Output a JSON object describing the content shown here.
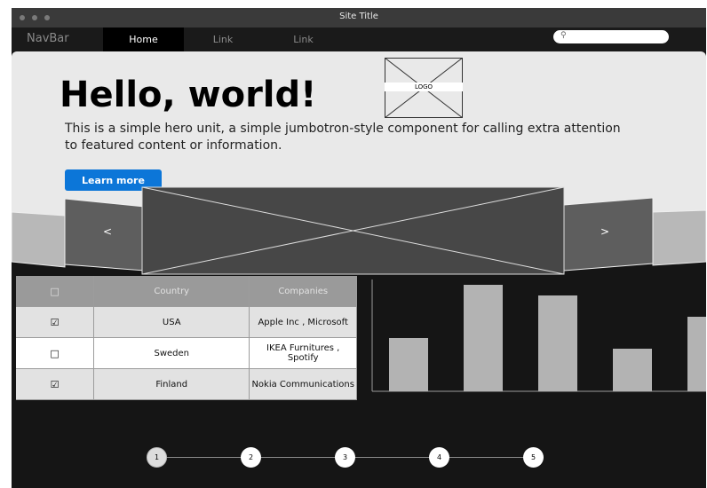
{
  "window": {
    "title": "Site Title"
  },
  "navbar": {
    "brand": "NavBar",
    "links": [
      {
        "label": "Home",
        "active": true
      },
      {
        "label": "Link",
        "active": false
      },
      {
        "label": "Link",
        "active": false
      }
    ],
    "search": {
      "placeholder": "",
      "icon": "search-icon"
    }
  },
  "hero": {
    "heading": "Hello, world!",
    "text": "This is a simple hero unit, a simple jumbotron-style component for calling extra attention to featured content or information.",
    "button_label": "Learn more",
    "logo_label": "LOGO",
    "button_color": "#0c76d8"
  },
  "carousel": {
    "prev_label": "<",
    "next_label": ">"
  },
  "table": {
    "headers": [
      "",
      "Country",
      "Companies"
    ],
    "rows": [
      {
        "checked": true,
        "country": "USA",
        "companies": "Apple Inc , Microsoft"
      },
      {
        "checked": false,
        "country": "Sweden",
        "companies": "IKEA Furnitures , Spotify"
      },
      {
        "checked": true,
        "country": "Finland",
        "companies": "Nokia Communications"
      }
    ]
  },
  "chart_data": {
    "type": "bar",
    "categories": [
      "",
      "",
      "",
      "",
      ""
    ],
    "values": [
      0.5,
      1.0,
      0.9,
      0.4,
      0.7
    ],
    "title": "",
    "xlabel": "",
    "ylabel": "",
    "ylim": [
      0,
      1.0
    ],
    "grid": false,
    "bar_color": "#b3b3b3"
  },
  "pagination": {
    "steps": [
      "1",
      "2",
      "3",
      "4",
      "5"
    ],
    "current": "1"
  }
}
